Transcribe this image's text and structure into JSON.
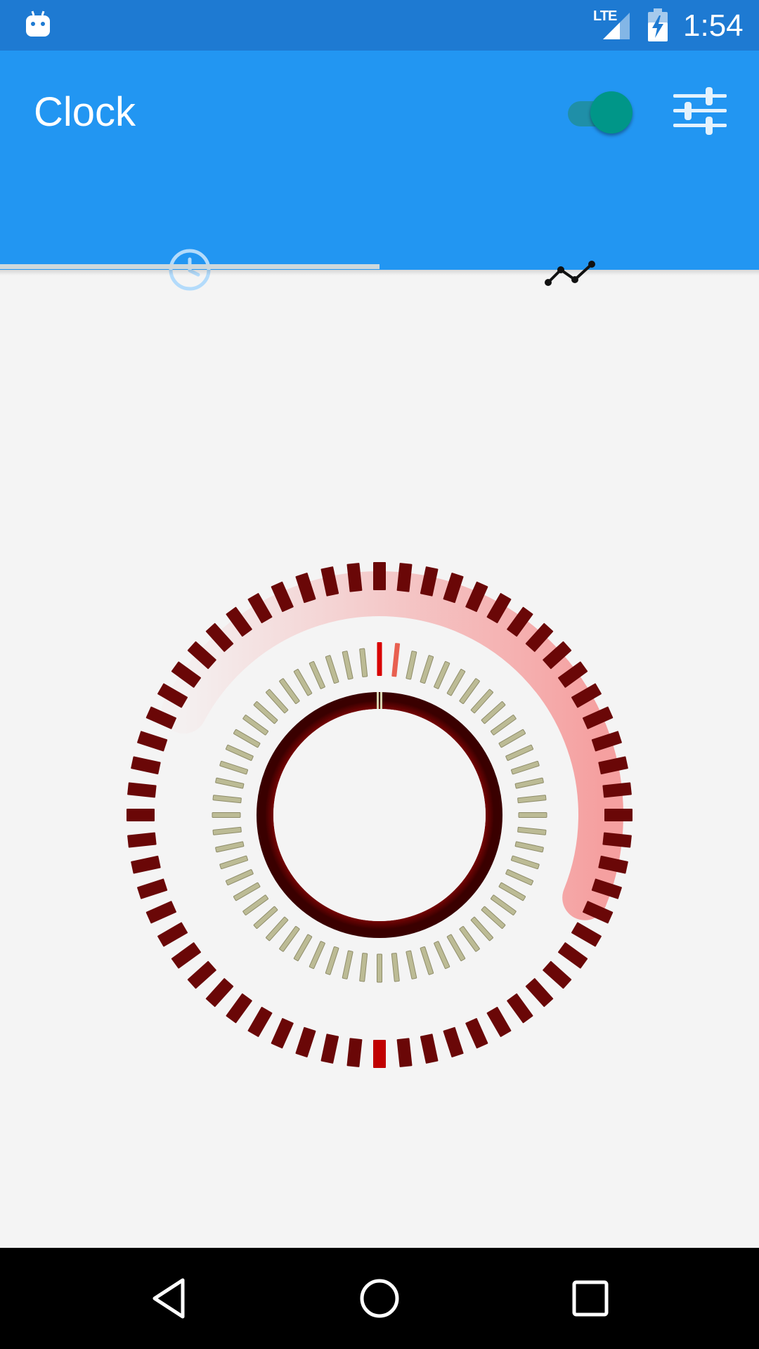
{
  "status_bar": {
    "time": "1:54",
    "network_label": "LTE",
    "icons": [
      "android-notification-icon",
      "signal-icon",
      "battery-charging-icon"
    ]
  },
  "app_bar": {
    "title": "Clock",
    "toggle_on": true,
    "toggle_color": "#009688",
    "actions": [
      "toggle-switch",
      "settings-sliders-icon"
    ]
  },
  "tabs": [
    {
      "icon": "clock-icon",
      "selected": true
    },
    {
      "icon": "line-chart-icon",
      "selected": false
    }
  ],
  "clock_gauge": {
    "outer_ticks": 60,
    "outer_highlight_tick": 30,
    "inner_ticks": 60,
    "inner_highlight_ticks": [
      0,
      1
    ],
    "progress_arc_fraction": 0.64,
    "colors": {
      "outer_tick": "#6a0707",
      "outer_tick_highlight": "#c00000",
      "inner_tick": "#bcbb95",
      "inner_tick_highlight": "#e01010",
      "progress_arc": "#f5a0a0",
      "dial_ring": "#4a0202"
    }
  },
  "nav_bar": {
    "buttons": [
      "back-icon",
      "home-icon",
      "recents-icon"
    ]
  },
  "colors": {
    "status_bar": "#1e7ad2",
    "app_bar": "#2296f2",
    "background": "#f4f4f4",
    "nav_bar": "#000000"
  }
}
